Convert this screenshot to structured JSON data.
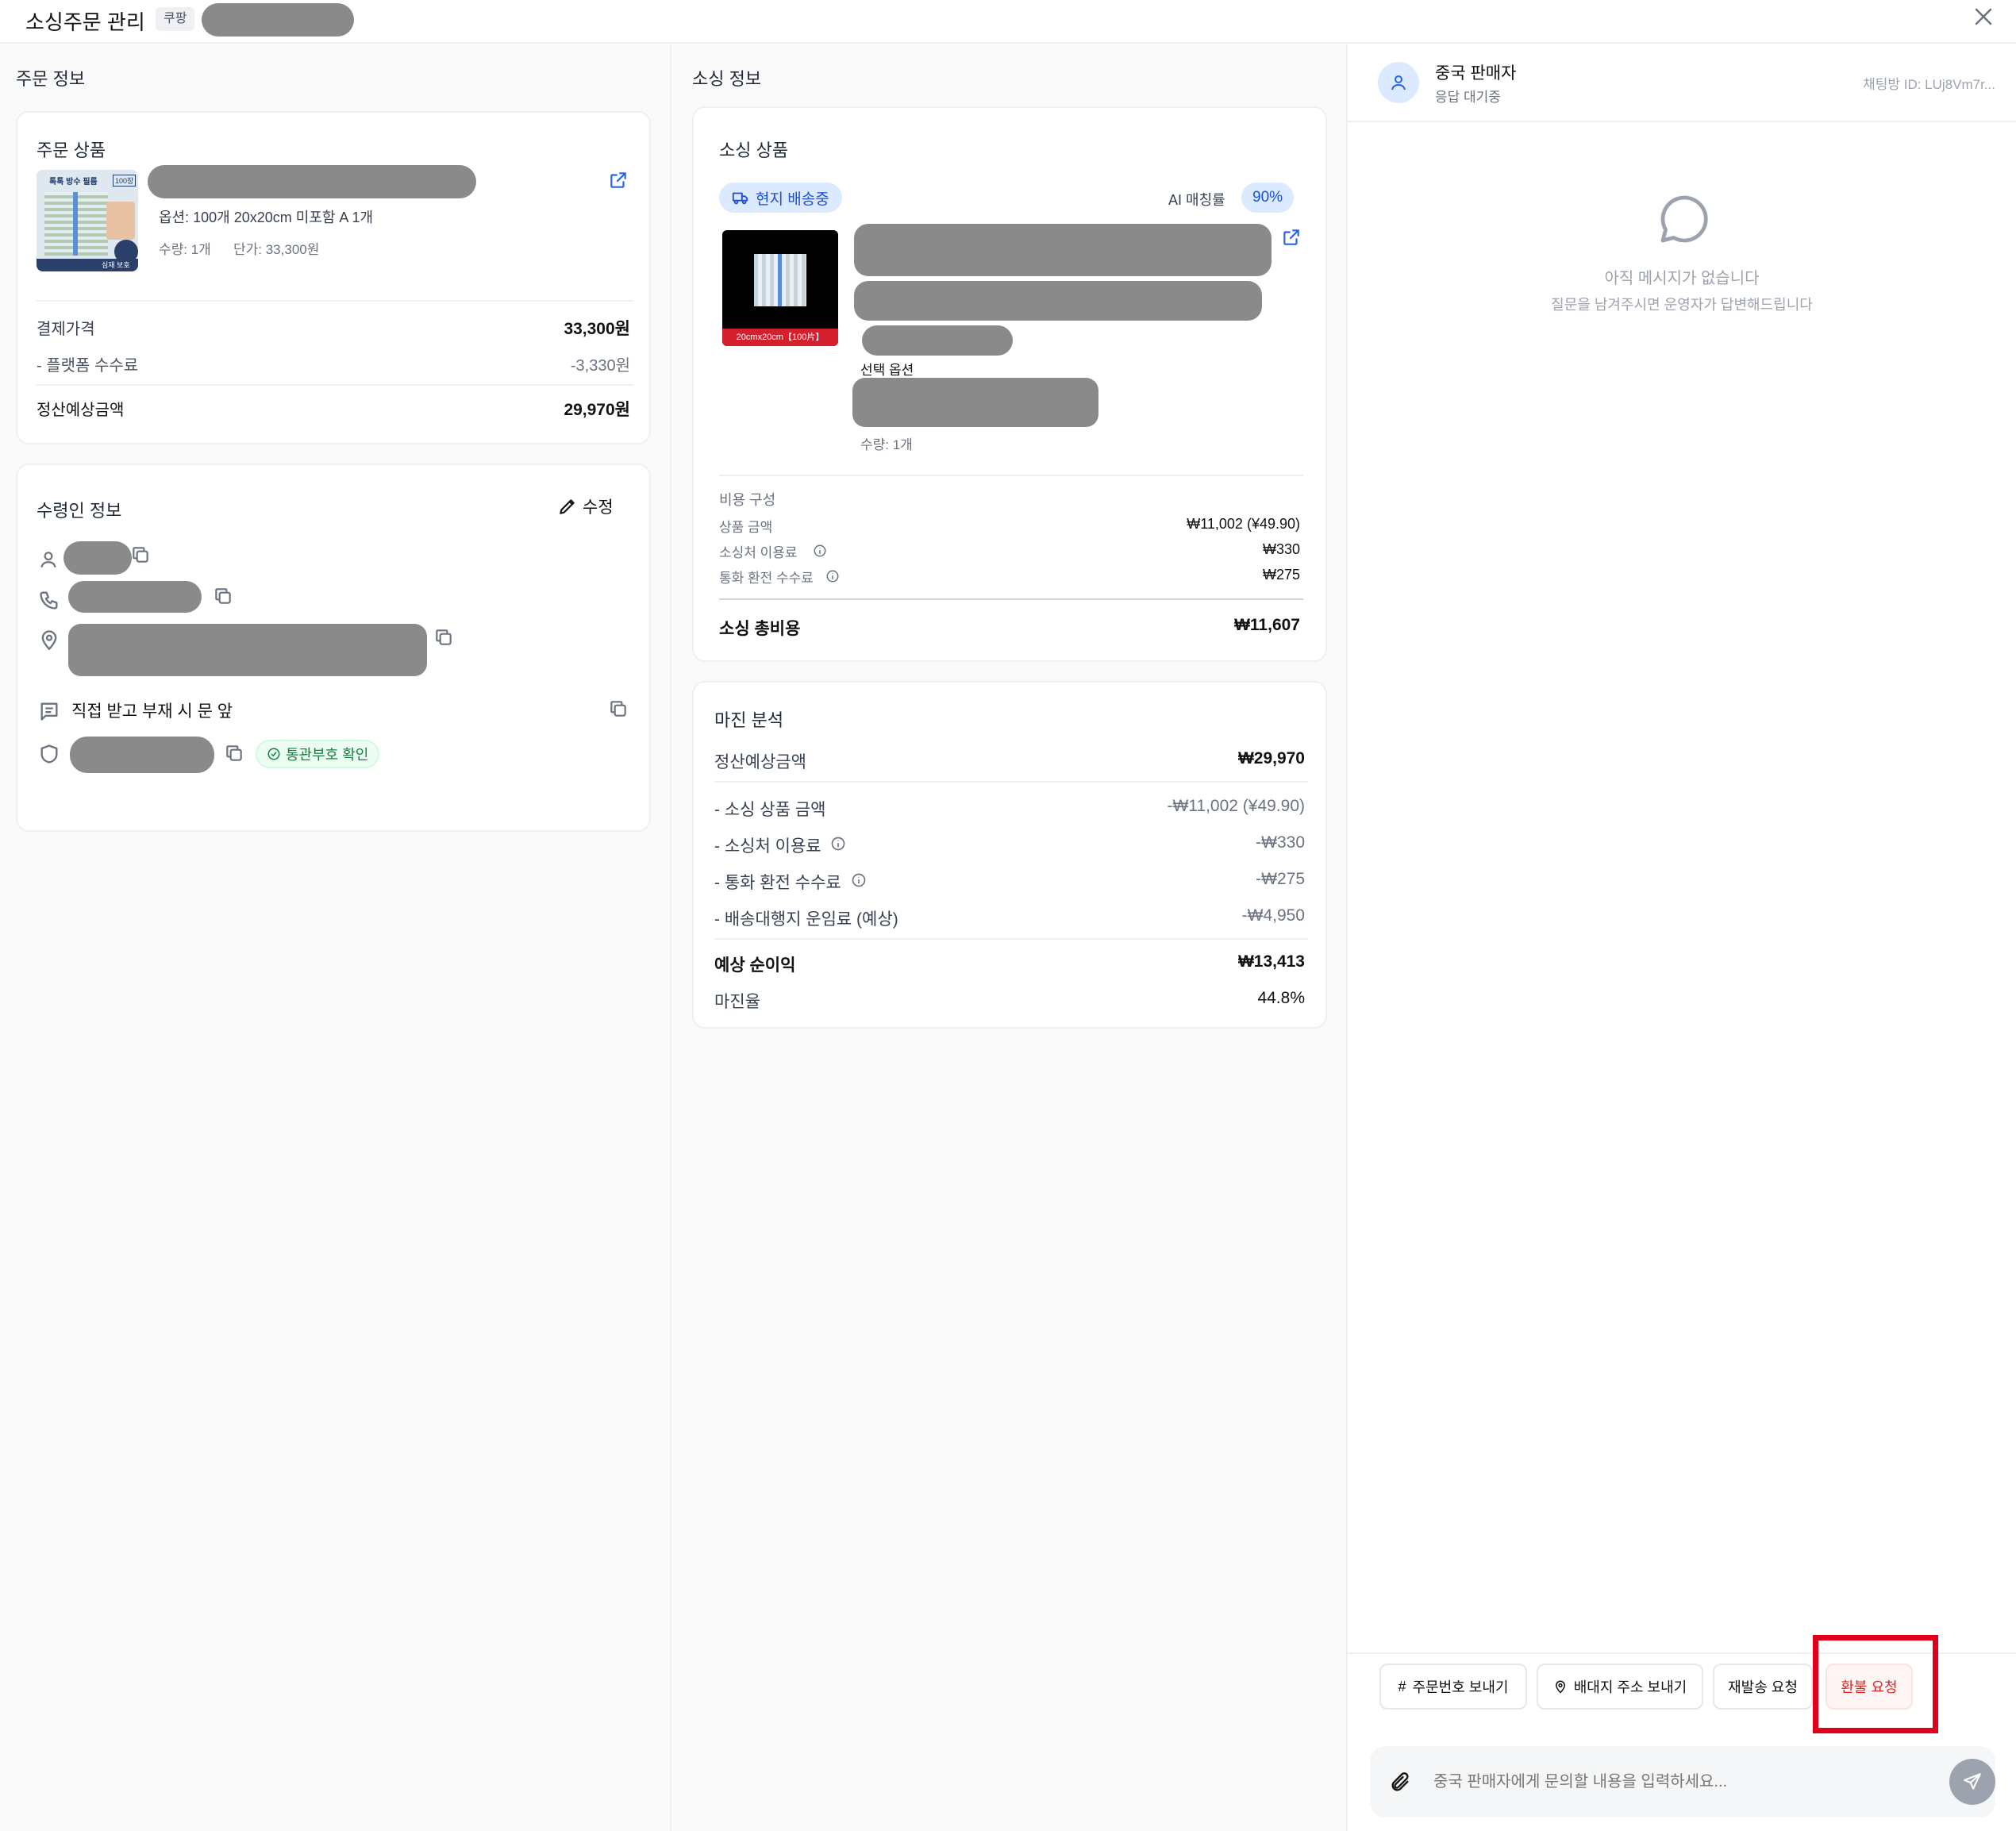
{
  "header": {
    "title": "소싱주문 관리",
    "platform_badge": "쿠팡"
  },
  "order_info": {
    "section_title": "주문 정보",
    "product_card": {
      "title": "주문 상품",
      "thumb_title": "톡톡 방수 필름",
      "thumb_count": "100장",
      "thumb_footer": "심재 보호",
      "option": "옵션: 100개 20x20cm 미포함 A 1개",
      "quantity": "수량: 1개",
      "unit_price": "단가: 33,300원",
      "payment_label": "결제가격",
      "payment_value": "33,300원",
      "fee_label": "- 플랫폼 수수료",
      "fee_value": "-3,330원",
      "settle_label": "정산예상금액",
      "settle_value": "29,970원"
    },
    "recipient_card": {
      "title": "수령인 정보",
      "edit_label": "수정",
      "memo": "직접 받고 부재 시 문 앞",
      "customs_badge": "통관부호 확인"
    }
  },
  "sourcing_info": {
    "section_title": "소싱 정보",
    "product_card": {
      "title": "소싱 상품",
      "status_badge": "현지 배송중",
      "ai_label": "AI 매칭률",
      "ai_value": "90%",
      "thumb_caption": "20cmx20cm【100片】",
      "selected_option_label": "선택 옵션",
      "quantity": "수량: 1개",
      "cost_title": "비용 구성",
      "costs": [
        {
          "label": "상품 금액",
          "value": "₩11,002 (¥49.90)"
        },
        {
          "label": "소싱처 이용료",
          "value": "₩330"
        },
        {
          "label": "통화 환전 수수료",
          "value": "₩275"
        }
      ],
      "total_label": "소싱 총비용",
      "total_value": "₩11,607"
    },
    "margin_card": {
      "title": "마진 분석",
      "settle_label": "정산예상금액",
      "settle_value": "₩29,970",
      "rows": [
        {
          "label": "- 소싱 상품 금액",
          "value": "-₩11,002 (¥49.90)"
        },
        {
          "label": "- 소싱처 이용료",
          "value": "-₩330"
        },
        {
          "label": "- 통화 환전 수수료",
          "value": "-₩275"
        },
        {
          "label": "- 배송대행지 운임료 (예상)",
          "value": "-₩4,950"
        }
      ],
      "profit_label": "예상 순이익",
      "profit_value": "₩13,413",
      "margin_label": "마진율",
      "margin_value": "44.8%"
    }
  },
  "chat": {
    "seller_name": "중국 판매자",
    "seller_status": "응답 대기중",
    "room_id": "채팅방 ID: LUj8Vm7r...",
    "empty_title": "아직 메시지가 없습니다",
    "empty_subtitle": "질문을 남겨주시면 운영자가 답변해드립니다",
    "actions": {
      "send_order_no": "주문번호 보내기",
      "send_address": "배대지 주소 보내기",
      "resend": "재발송 요청",
      "refund": "환불 요청"
    },
    "input_placeholder": "중국 판매자에게 문의할 내용을 입력하세요..."
  },
  "colors": {
    "accent": "#2563eb",
    "refund": "#dc2626",
    "highlight": "#e0001b",
    "blur": "#8a8a8a"
  }
}
